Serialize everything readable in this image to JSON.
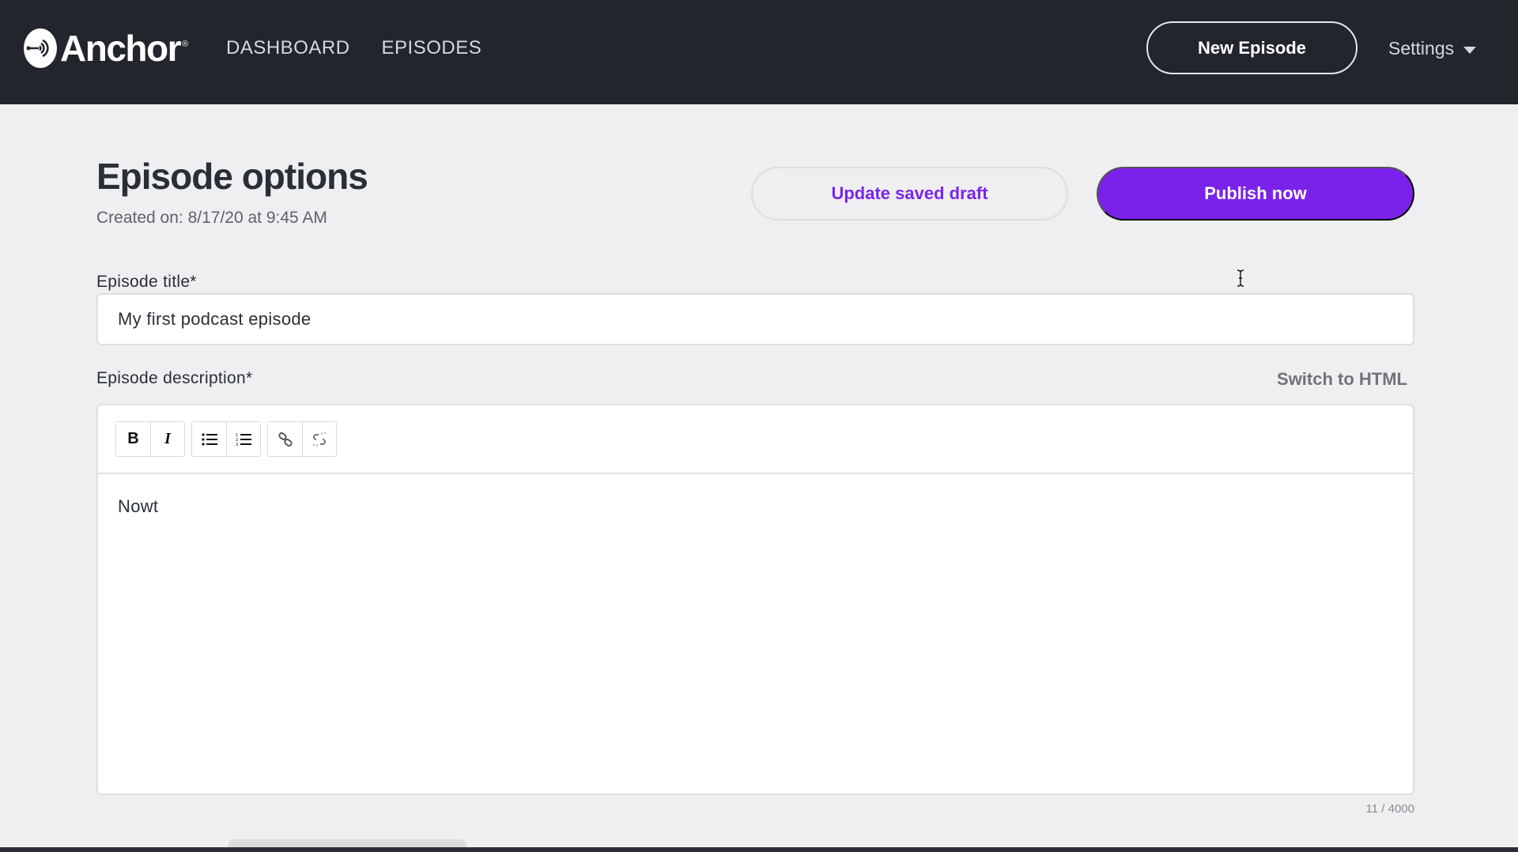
{
  "header": {
    "brand": "Anchor",
    "brand_mark": "®",
    "nav": [
      {
        "label": "DASHBOARD"
      },
      {
        "label": "EPISODES"
      }
    ],
    "new_episode_label": "New Episode",
    "settings_label": "Settings"
  },
  "page": {
    "title": "Episode options",
    "created": "Created on: 8/17/20 at 9:45 AM",
    "update_draft_label": "Update saved draft",
    "publish_label": "Publish now"
  },
  "form": {
    "title_label": "Episode title*",
    "title_value": "My first podcast episode",
    "description_label": "Episode description*",
    "switch_html_label": "Switch to HTML",
    "toolbar": {
      "bold": "B",
      "italic": "I",
      "icons": [
        "bold-icon",
        "italic-icon",
        "bulleted-list-icon",
        "numbered-list-icon",
        "link-icon",
        "unlink-icon"
      ]
    },
    "description_value": "Nowt",
    "char_count": "11 / 4000"
  },
  "colors": {
    "header_bg": "#23252d",
    "accent": "#7b22ea",
    "page_bg": "#efeff1"
  }
}
